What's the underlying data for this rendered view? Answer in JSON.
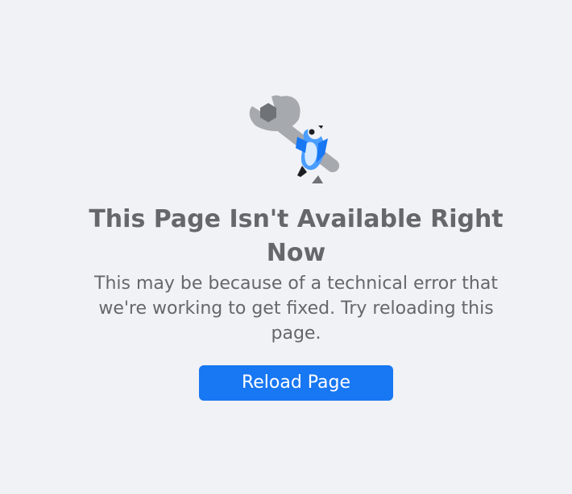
{
  "error": {
    "title": "This Page Isn't Available Right Now",
    "message": "This may be because of a technical error that we're working to get fixed. Try reloading this page.",
    "reload_label": "Reload Page",
    "illustration_icon": "wrench-bird-icon"
  },
  "colors": {
    "background": "#f0f2f5",
    "text": "#65676b",
    "button": "#1877f2",
    "button_text": "#ffffff"
  }
}
